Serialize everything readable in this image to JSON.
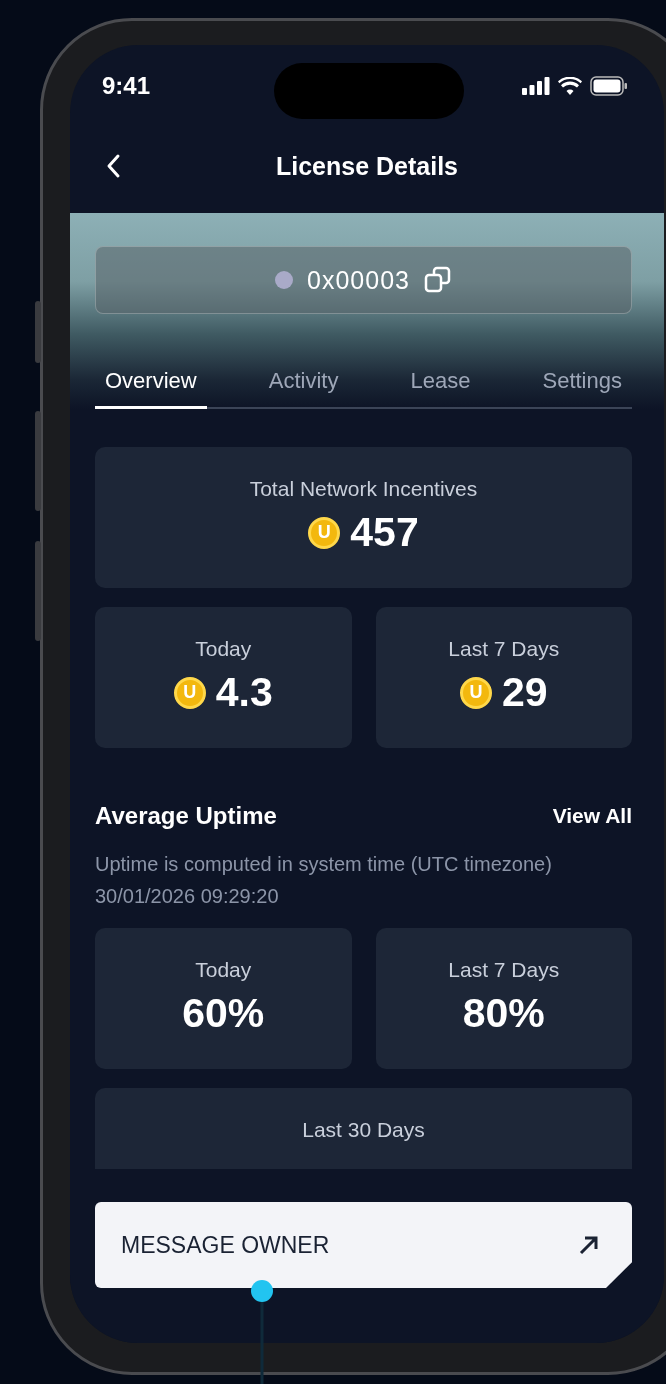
{
  "status_bar": {
    "time": "9:41"
  },
  "header": {
    "title": "License Details"
  },
  "license": {
    "id": "0x00003"
  },
  "tabs": [
    {
      "label": "Overview",
      "selected": true
    },
    {
      "label": "Activity",
      "selected": false
    },
    {
      "label": "Lease",
      "selected": false
    },
    {
      "label": "Settings",
      "selected": false
    }
  ],
  "total": {
    "label": "Total Network Incentives",
    "coin": "U",
    "value": "457"
  },
  "incentives": [
    {
      "label": "Today",
      "coin": "U",
      "value": "4.3"
    },
    {
      "label": "Last 7 Days",
      "coin": "U",
      "value": "29"
    }
  ],
  "uptime": {
    "title": "Average Uptime",
    "link": "View All",
    "note": "Uptime is computed in system time (UTC timezone)",
    "timestamp": "30/01/2026 09:29:20",
    "stats": [
      {
        "label": "Today",
        "value": "60%"
      },
      {
        "label": "Last 7 Days",
        "value": "80%"
      },
      {
        "label": "Last 30 Days"
      }
    ]
  },
  "action": {
    "label": "MESSAGE OWNER"
  }
}
